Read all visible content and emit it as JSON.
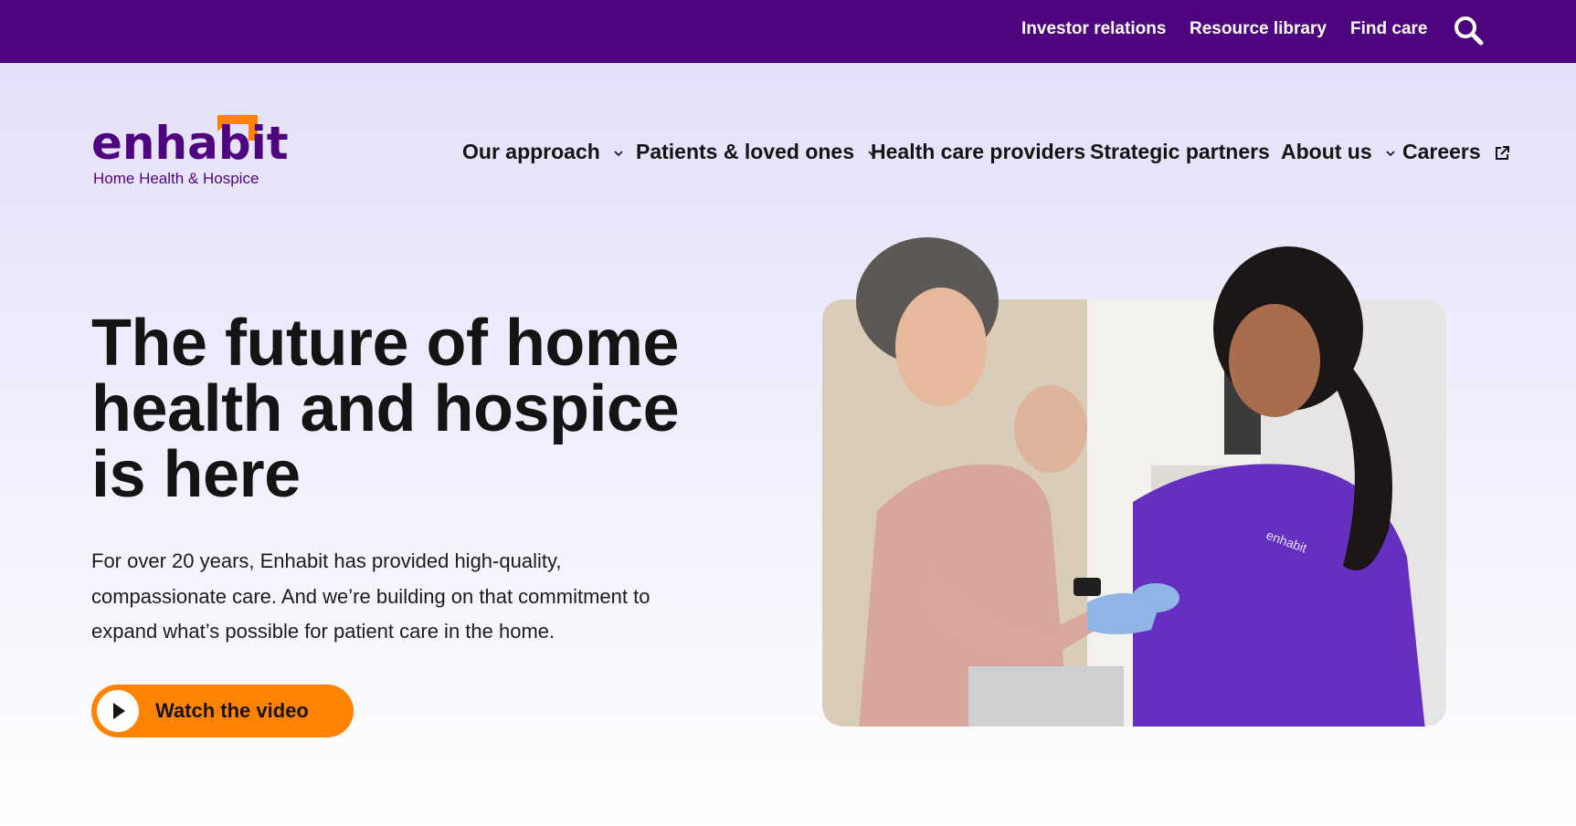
{
  "utility_nav": {
    "links": [
      {
        "label": "Investor relations"
      },
      {
        "label": "Resource library"
      },
      {
        "label": "Find care"
      }
    ],
    "search_icon": "search-icon"
  },
  "logo": {
    "wordmark": "enhabit",
    "tagline": "Home Health & Hospice"
  },
  "main_nav": {
    "items": [
      {
        "label": "Our approach",
        "icon": "chevron-down-icon"
      },
      {
        "label": "Patients & loved ones",
        "icon": "chevron-down-icon"
      },
      {
        "label": "Health care providers"
      },
      {
        "label": "Strategic partners"
      },
      {
        "label": "About us",
        "icon": "chevron-down-icon"
      },
      {
        "label": "Careers",
        "icon": "external-link-icon"
      }
    ]
  },
  "hero": {
    "title": "The future of home health and hospice is here",
    "body": "For over 20 years, Enhabit has provided high-quality, compassionate care. And we’re building on that commitment to expand what’s possible for patient care in the home.",
    "cta_label": "Watch the video",
    "cta_icon": "play-icon"
  },
  "colors": {
    "brand_purple": "#4f047f",
    "accent_orange": "#ff8300"
  }
}
